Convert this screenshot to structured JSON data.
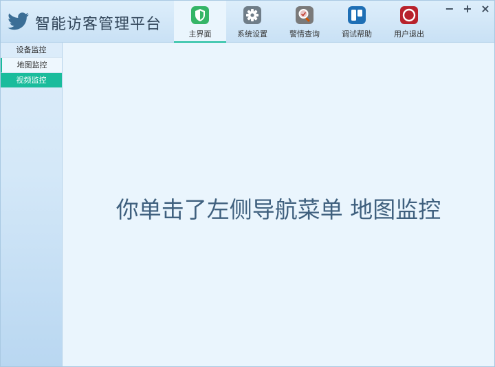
{
  "app": {
    "title": "智能访客管理平台",
    "logo_icon": "bird-icon"
  },
  "nav": {
    "tabs": [
      {
        "label": "主界面",
        "icon": "shield-icon",
        "active": true
      },
      {
        "label": "系统设置",
        "icon": "gear-icon",
        "active": false
      },
      {
        "label": "警情查询",
        "icon": "magnifier-icon",
        "active": false
      },
      {
        "label": "调试帮助",
        "icon": "board-icon",
        "active": false
      },
      {
        "label": "用户退出",
        "icon": "power-icon",
        "active": false
      }
    ]
  },
  "window_controls": {
    "minimize": "−",
    "maximize": "+",
    "close": "×"
  },
  "sidebar": {
    "items": [
      {
        "label": "设备监控",
        "state": "normal"
      },
      {
        "label": "地图监控",
        "state": "hover"
      },
      {
        "label": "视频监控",
        "state": "active"
      }
    ]
  },
  "main": {
    "message": "你单击了左侧导航菜单 地图监控"
  },
  "colors": {
    "accent": "#1abc9c",
    "background": "#eaf5fd",
    "message_text": "#3f607e"
  }
}
